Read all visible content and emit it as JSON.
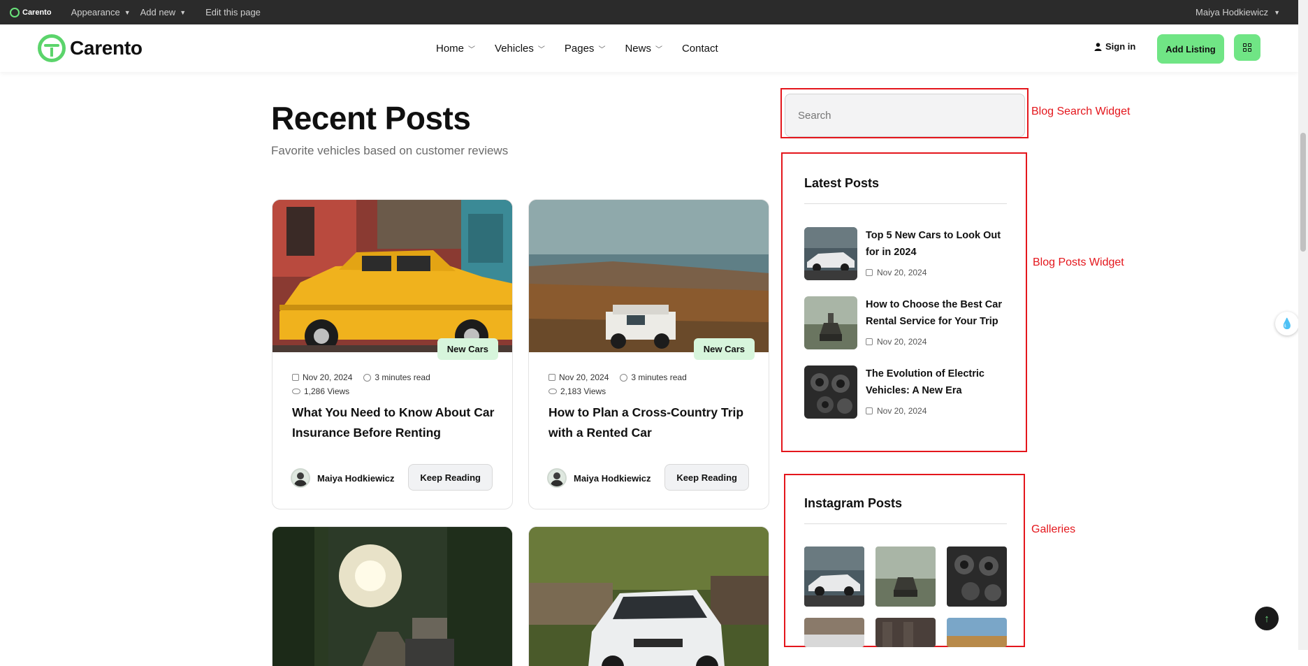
{
  "adminbar": {
    "logo": "Carento",
    "appearance": "Appearance",
    "add_new": "Add new",
    "edit_page": "Edit this page",
    "user": "Maiya Hodkiewicz"
  },
  "header": {
    "logo": "Carento",
    "nav": [
      "Home",
      "Vehicles",
      "Pages",
      "News",
      "Contact"
    ],
    "signin": "Sign in",
    "add_listing": "Add Listing"
  },
  "main": {
    "title": "Recent Posts",
    "subtitle": "Favorite vehicles based on customer reviews",
    "posts": [
      {
        "badge": "New Cars",
        "date": "Nov 20, 2024",
        "read": "3 minutes read",
        "views": "1,286 Views",
        "title": "What You Need to Know About Car Insurance Before Renting",
        "author": "Maiya Hodkiewicz",
        "cta": "Keep Reading"
      },
      {
        "badge": "New Cars",
        "date": "Nov 20, 2024",
        "read": "3 minutes read",
        "views": "2,183 Views",
        "title": "How to Plan a Cross-Country Trip with a Rented Car",
        "author": "Maiya Hodkiewicz",
        "cta": "Keep Reading"
      }
    ]
  },
  "sidebar": {
    "search_placeholder": "Search",
    "search_label": "Blog Search Widget",
    "latest_title": "Latest Posts",
    "latest_label": "Blog Posts Widget",
    "latest": [
      {
        "title": "Top 5 New Cars to Look Out for in 2024",
        "date": "Nov 20, 2024"
      },
      {
        "title": "How to Choose the Best Car Rental Service for Your Trip",
        "date": "Nov 20, 2024"
      },
      {
        "title": "The Evolution of Electric Vehicles: A New Era",
        "date": "Nov 20, 2024"
      }
    ],
    "instagram_title": "Instagram Posts",
    "galleries_label": "Galleries"
  },
  "colors": {
    "accent": "#70e585",
    "annotation": "#e4161c",
    "badge_bg": "#d7f5dc"
  }
}
